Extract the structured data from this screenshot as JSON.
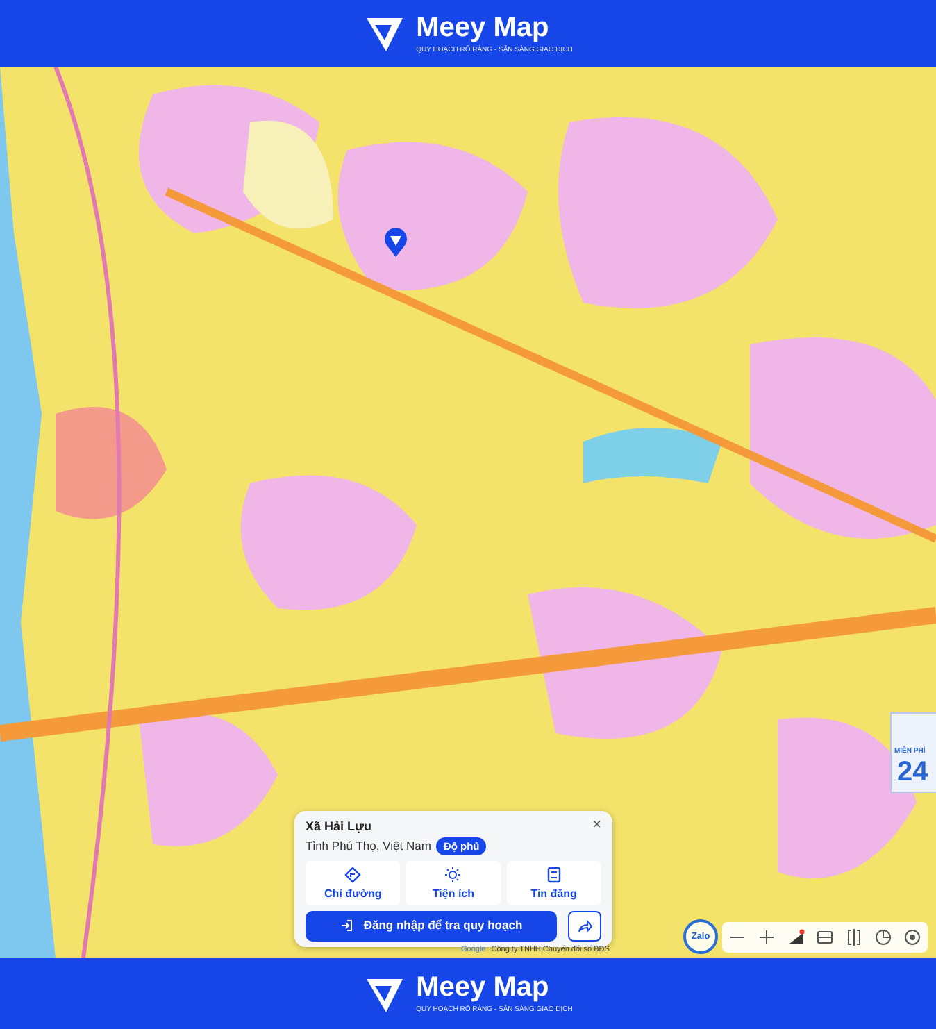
{
  "header": {
    "brand": "Meey Map",
    "tagline": "QUY HOẠCH RÕ RÀNG - SẴN SÀNG GIAO DỊCH"
  },
  "ad_banner": {
    "heading": "MIỄN PHÍ",
    "number": "24"
  },
  "location_card": {
    "close": "×",
    "title": "Xã Hải Lựu",
    "subtitle": "Tỉnh Phú Thọ, Việt Nam",
    "badge": "Độ phủ",
    "actions": [
      {
        "kind": "directions",
        "label": "Chỉ đường"
      },
      {
        "kind": "amenities",
        "label": "Tiện ích"
      },
      {
        "kind": "listings",
        "label": "Tin đăng"
      }
    ],
    "login_button": "Đăng nhập để tra quy hoạch"
  },
  "attribution": {
    "logo": "Google",
    "text": "Công ty TNHH Chuyển đổi số BĐS"
  },
  "zalo_button": "Zalo",
  "map_tools": [
    {
      "kind": "minus"
    },
    {
      "kind": "plus"
    },
    {
      "kind": "draw"
    },
    {
      "kind": "split"
    },
    {
      "kind": "compare"
    },
    {
      "kind": "layers"
    },
    {
      "kind": "locate"
    }
  ],
  "footer": {
    "brand": "Meey Map",
    "tagline": "QUY HOẠCH RÕ RÀNG - SẴN SÀNG GIAO DỊCH"
  }
}
